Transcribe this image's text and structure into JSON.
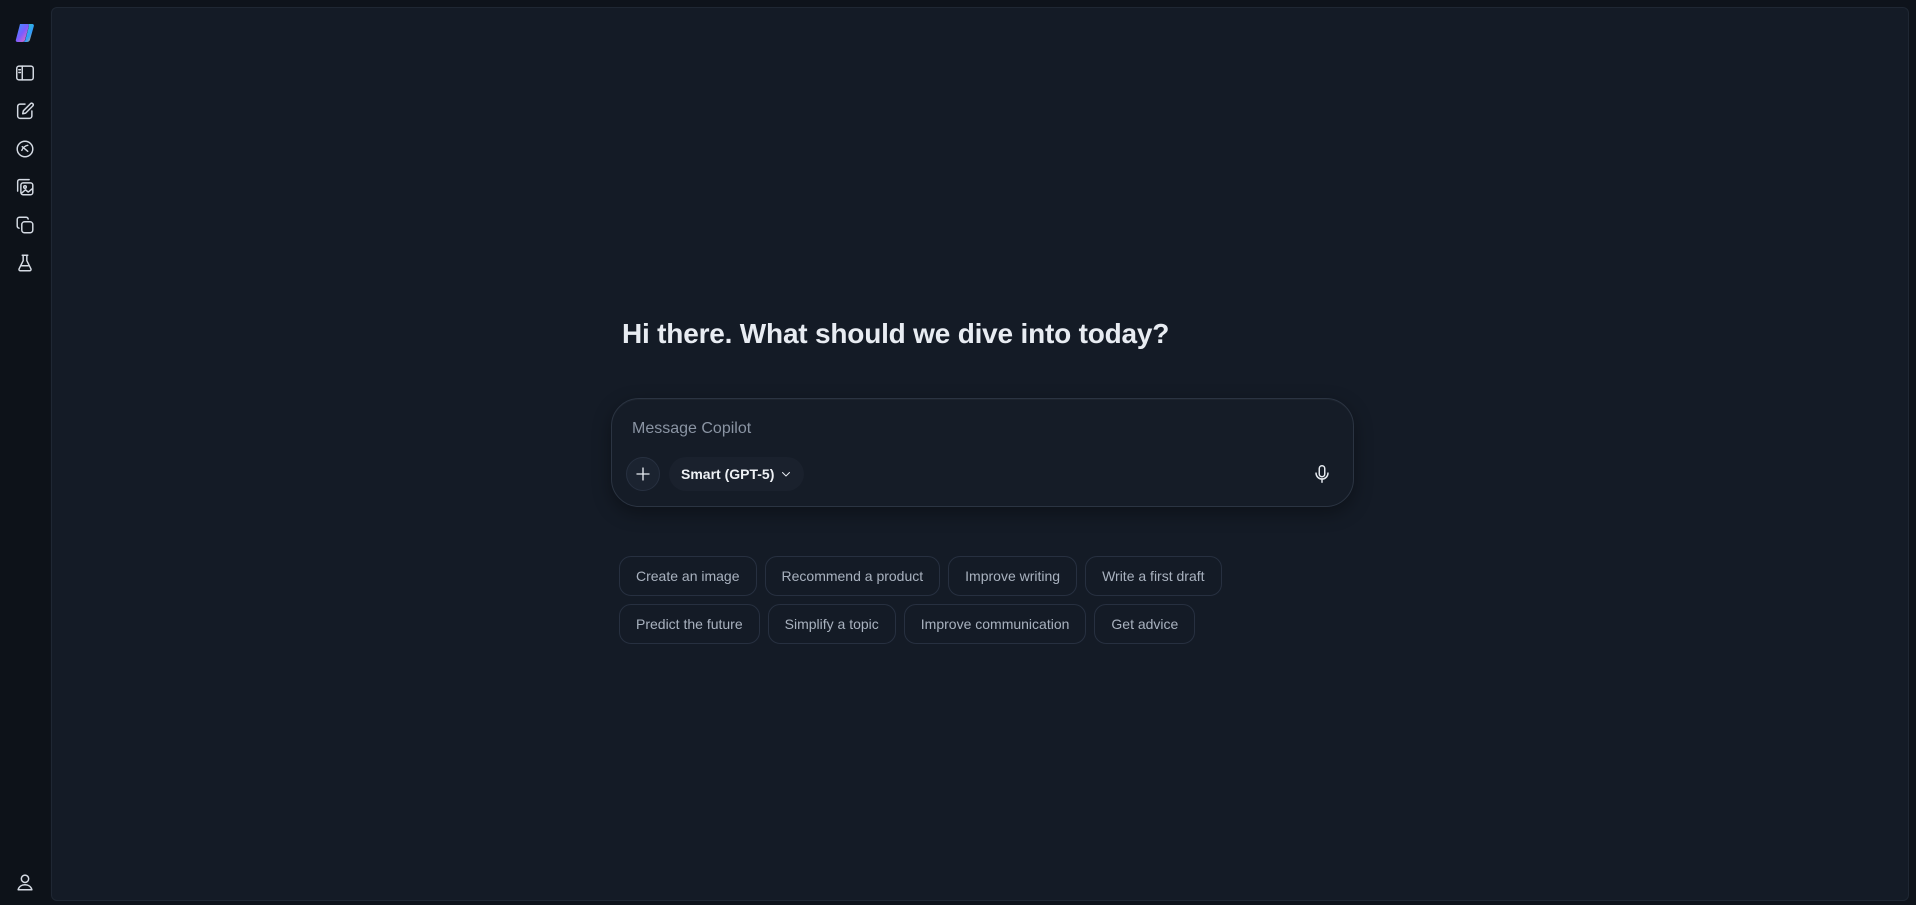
{
  "rail": {
    "items": [
      {
        "name": "copilot-logo-icon"
      },
      {
        "name": "sidebar-toggle-icon"
      },
      {
        "name": "new-chat-icon"
      },
      {
        "name": "discover-icon"
      },
      {
        "name": "image-gallery-icon"
      },
      {
        "name": "pages-icon"
      },
      {
        "name": "labs-flask-icon"
      },
      {
        "name": "profile-icon"
      }
    ]
  },
  "main": {
    "greeting": "Hi there. What should we dive into today?",
    "composer": {
      "placeholder": "Message Copilot",
      "value": "",
      "model_label": "Smart (GPT-5)"
    },
    "suggestions_row1": [
      "Create an image",
      "Recommend a product",
      "Improve writing",
      "Write a first draft"
    ],
    "suggestions_row2": [
      "Predict the future",
      "Simplify a topic",
      "Improve communication",
      "Get advice"
    ]
  },
  "colors": {
    "background": "#0e131b",
    "panel": "#141b26",
    "border": "#273040",
    "text_primary": "#e8ecf2",
    "text_muted": "#a9b2bf",
    "placeholder": "#8a94a3"
  }
}
